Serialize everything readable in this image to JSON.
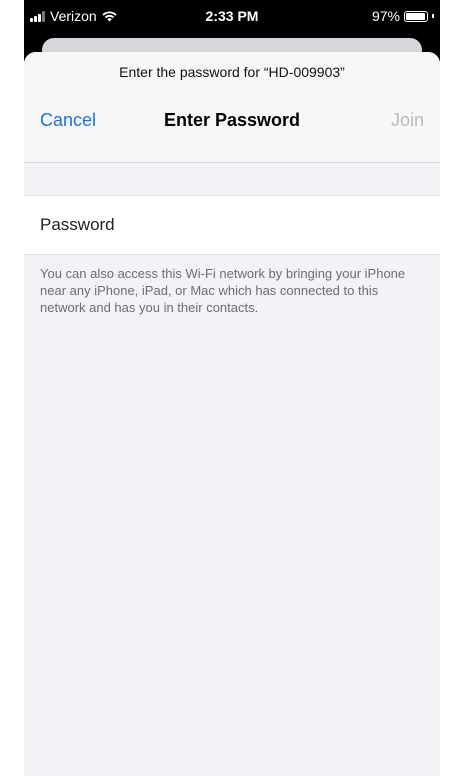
{
  "status_bar": {
    "carrier": "Verizon",
    "time": "2:33 PM",
    "battery_percent_label": "97%",
    "battery_level": 0.97,
    "icons": [
      "signal-icon",
      "wifi-icon",
      "battery-icon"
    ]
  },
  "sheet": {
    "prompt": "Enter the password for “HD-009903”",
    "cancel_label": "Cancel",
    "title": "Enter Password",
    "join_label": "Join",
    "password_placeholder": "Password",
    "footnote": "You can also access this Wi-Fi network by bringing your iPhone near any iPhone, iPad, or Mac which has connected to this network and has you in their contacts."
  },
  "colors": {
    "accent": "#1a73e8",
    "disabled": "#b9b9be",
    "background": "#f2f2f7"
  }
}
